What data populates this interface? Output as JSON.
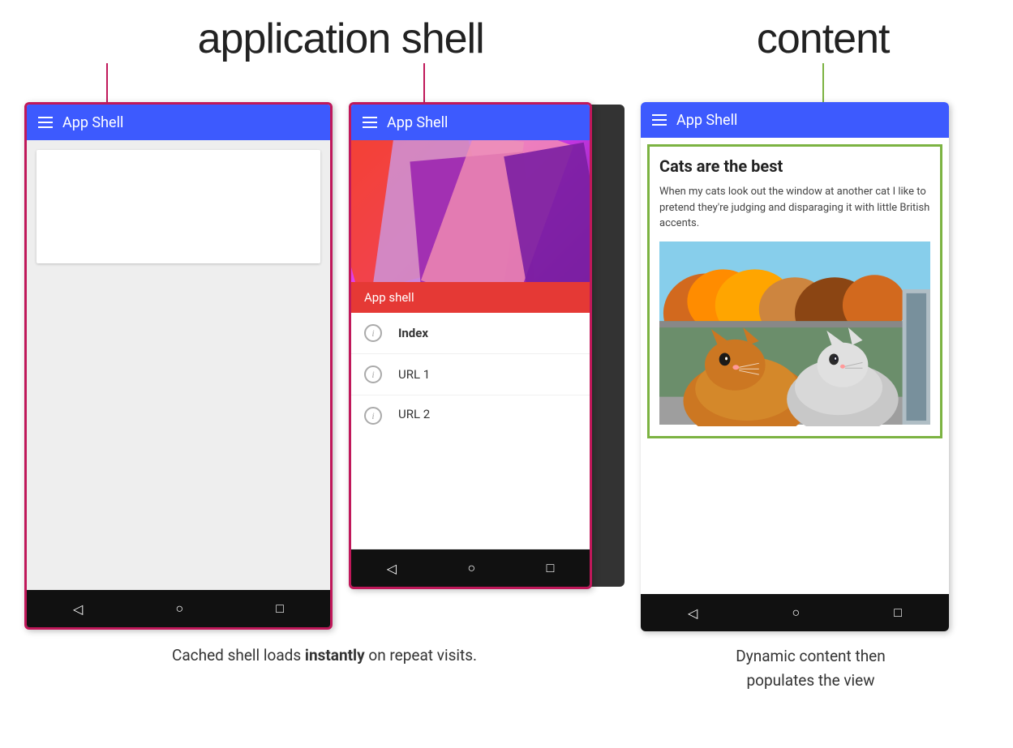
{
  "header": {
    "app_shell_label": "application shell",
    "content_label": "content"
  },
  "phone1": {
    "app_bar_title": "App Shell",
    "border_color": "#c0185a"
  },
  "phone2": {
    "app_bar_title": "App Shell",
    "hero_label": "App shell",
    "drawer_items": [
      {
        "label": "Index",
        "bold": true
      },
      {
        "label": "URL 1",
        "bold": false
      },
      {
        "label": "URL 2",
        "bold": false
      }
    ],
    "border_color": "#c0185a"
  },
  "phone3": {
    "app_bar_title": "App Shell",
    "content_title": "Cats are the best",
    "content_text": "When my cats look out the window at another cat I like to pretend they're judging and disparaging it with little British accents.",
    "border_color": "#7cb342"
  },
  "captions": {
    "left": "Cached shell loads instantly on repeat visits.",
    "left_bold": "instantly",
    "right_line1": "Dynamic content then",
    "right_line2": "populates the view"
  },
  "nav": {
    "back": "◁",
    "home": "○",
    "recent": "□"
  }
}
